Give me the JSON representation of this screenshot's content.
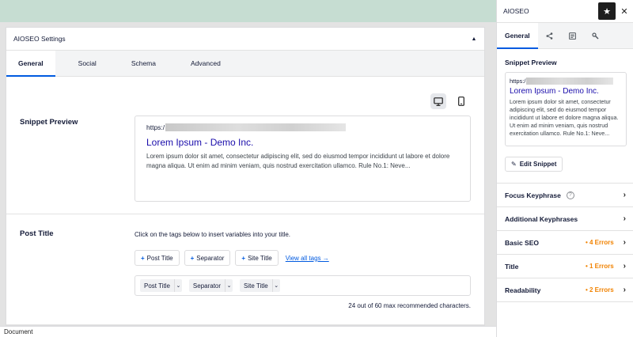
{
  "main": {
    "panel_title": "AIOSEO Settings",
    "tabs": [
      {
        "label": "General"
      },
      {
        "label": "Social"
      },
      {
        "label": "Schema"
      },
      {
        "label": "Advanced"
      }
    ],
    "snippet_preview": {
      "label": "Snippet Preview",
      "url_prefix": "https:/",
      "title": "Lorem Ipsum - Demo Inc.",
      "description": "Lorem ipsum dolor sit amet, consectetur adipiscing elit, sed do eiusmod tempor incididunt ut labore et dolore magna aliqua. Ut enim ad minim veniam, quis nostrud exercitation ullamco. Rule No.1: Neve..."
    },
    "post_title": {
      "label": "Post Title",
      "help_text": "Click on the tags below to insert variables into your title.",
      "tag_buttons": [
        "Post Title",
        "Separator",
        "Site Title"
      ],
      "view_all_link": "View all tags →",
      "chips": [
        "Post Title",
        "Separator",
        "Site Title"
      ],
      "char_count": "24 out of 60 max recommended characters."
    }
  },
  "status_bar": {
    "text": "Document"
  },
  "sidebar": {
    "title": "AIOSEO",
    "tabs": [
      {
        "label": "General"
      }
    ],
    "snippet_title": "Snippet Preview",
    "snippet": {
      "url_prefix": "https:/",
      "title": "Lorem Ipsum - Demo Inc.",
      "description": "Lorem ipsum dolor sit amet, consectetur adipiscing elit, sed do eiusmod tempor incididunt ut labore et dolore magna aliqua. Ut enim ad minim veniam, quis nostrud exercitation ullamco. Rule No.1: Neve..."
    },
    "edit_snippet_label": "Edit Snippet",
    "items": [
      {
        "label": "Focus Keyphrase",
        "errors": ""
      },
      {
        "label": "Additional Keyphrases",
        "errors": ""
      },
      {
        "label": "Basic SEO",
        "errors": "• 4 Errors"
      },
      {
        "label": "Title",
        "errors": "• 1 Errors"
      },
      {
        "label": "Readability",
        "errors": "• 2 Errors"
      }
    ]
  },
  "colors": {
    "accent": "#005ae0",
    "link_title": "#1a0dab",
    "error": "#f18200",
    "top_bar": "#c6ddd2"
  },
  "icons": [
    "collapse-up-icon",
    "desktop-icon",
    "mobile-icon",
    "star-icon",
    "close-icon",
    "share-icon",
    "document-icon",
    "wrench-icon",
    "pencil-icon",
    "help-icon",
    "chevron-right-icon",
    "chevron-down-icon"
  ]
}
